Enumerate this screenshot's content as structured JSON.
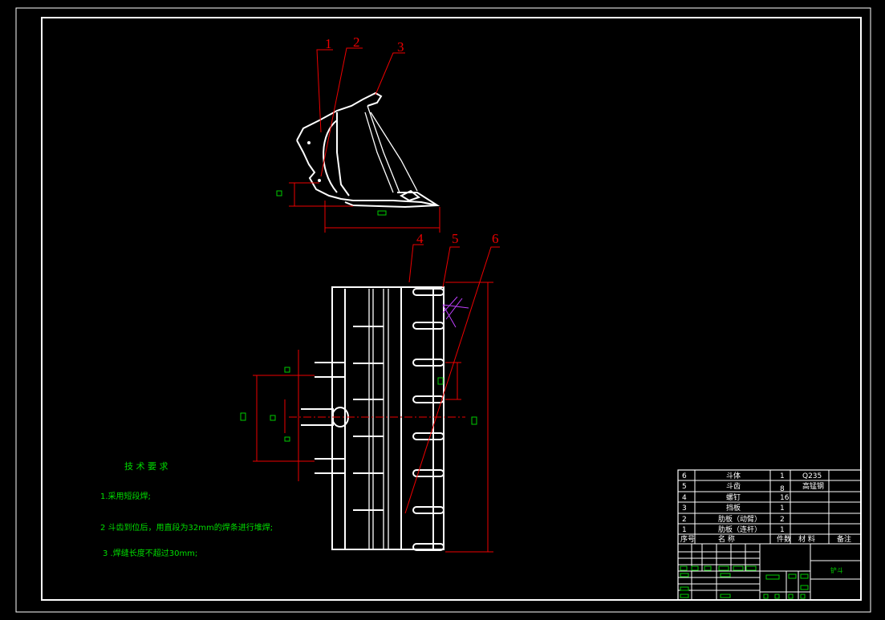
{
  "balloons": [
    "1",
    "2",
    "3",
    "4",
    "5",
    "6"
  ],
  "tech": {
    "title": "技 术 要 求",
    "notes": [
      "1.采用短段焊;",
      "2 斗齿到位后，用直段为32mm的焊条进行堆焊;",
      "3 .焊缝长度不超过30mm;"
    ]
  },
  "bom": {
    "rows": [
      {
        "no": "6",
        "name": "斗体",
        "qty": "1",
        "material": "Q235",
        "remark": ""
      },
      {
        "no": "5",
        "name": "斗齿",
        "qty": "8",
        "material": "高锰钢",
        "remark": ""
      },
      {
        "no": "4",
        "name": "螺钉",
        "qty": "16",
        "material": "",
        "remark": ""
      },
      {
        "no": "3",
        "name": "挡板",
        "qty": "1",
        "material": "",
        "remark": ""
      },
      {
        "no": "2",
        "name": "肋板（动臂）",
        "qty": "2",
        "material": "",
        "remark": ""
      },
      {
        "no": "1",
        "name": "肋板（连杆）",
        "qty": "1",
        "material": "",
        "remark": ""
      }
    ],
    "header": {
      "no": "序号",
      "name": "名  称",
      "qty": "件数",
      "material": "材  料",
      "remark": "备注"
    }
  },
  "title_block": {
    "drawing_name": "铲斗"
  },
  "colors": {
    "background": "#000000",
    "lines": "#ffffff",
    "leaders": "#e00000",
    "text": "#00dd00"
  }
}
